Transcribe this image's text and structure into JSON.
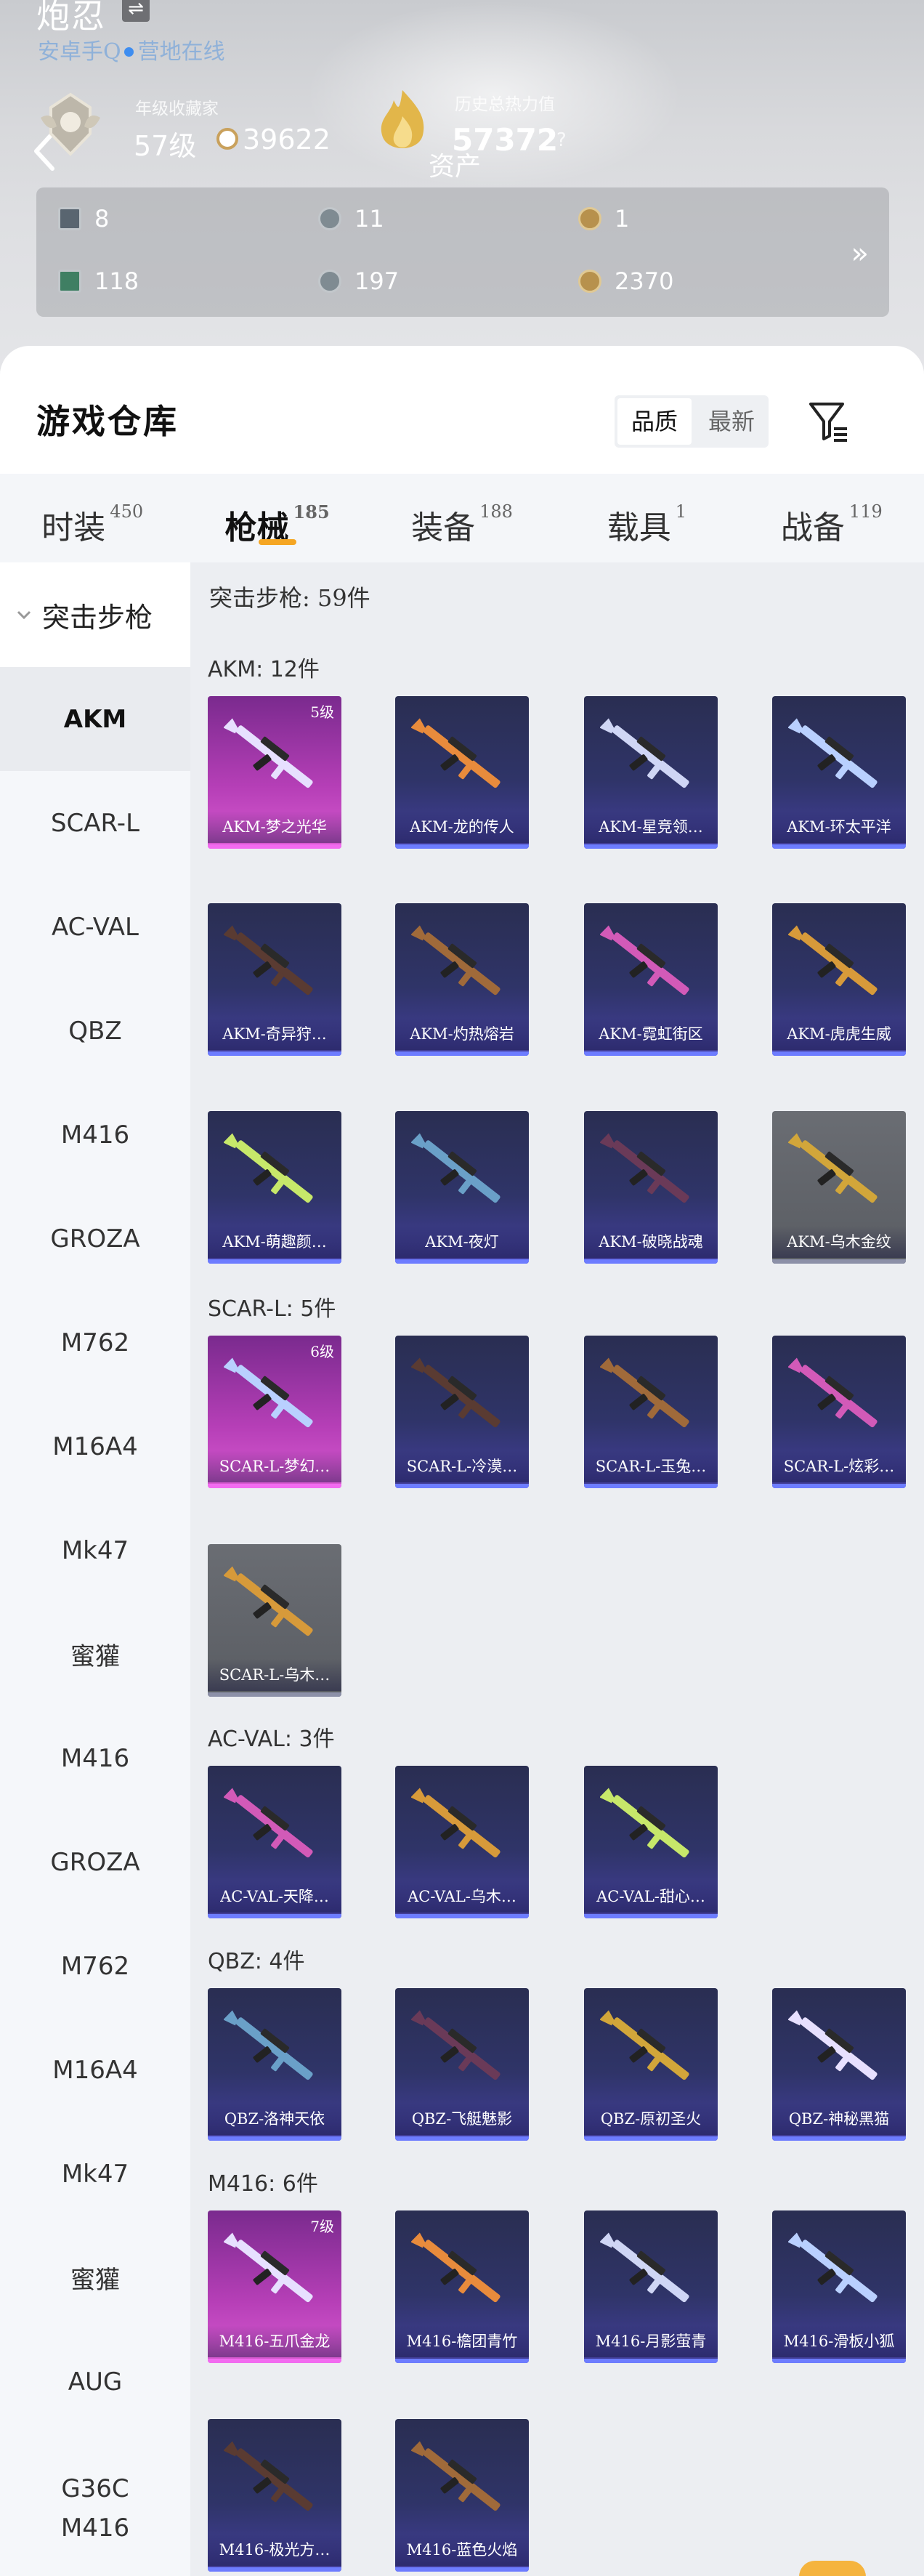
{
  "header": {
    "player_name": "炮忍",
    "region": "安卓手Q",
    "status": "营地在线",
    "label_collection": "年级收藏家",
    "level": "57级",
    "coins": "39622",
    "label_power": "历史总热力值",
    "power": "57372",
    "help": "?",
    "assets_title": "资产",
    "stats": [
      {
        "icon": "card-icon",
        "value": "8"
      },
      {
        "icon": "badge-icon",
        "value": "11"
      },
      {
        "icon": "coin-gold-icon",
        "value": "1"
      },
      {
        "icon": "ticket-icon",
        "value": "118"
      },
      {
        "icon": "sphere-icon",
        "value": "197"
      },
      {
        "icon": "medal-icon",
        "value": "2370"
      }
    ],
    "stats_more": "»"
  },
  "warehouse": {
    "title": "游戏仓库",
    "sort_options": [
      "品质",
      "最新"
    ],
    "sort_active": "品质"
  },
  "tabs": [
    {
      "label": "时装",
      "count": "450"
    },
    {
      "label": "枪械",
      "count": "185",
      "active": true
    },
    {
      "label": "装备",
      "count": "188"
    },
    {
      "label": "载具",
      "count": "1"
    },
    {
      "label": "战备",
      "count": "119"
    }
  ],
  "sidebar": {
    "category": "突击步枪",
    "items": [
      "AKM",
      "SCAR-L",
      "AC-VAL",
      "QBZ",
      "M416",
      "GROZA",
      "M762",
      "M16A4",
      "Mk47",
      "蜜獾",
      "M416",
      "GROZA",
      "M762",
      "M16A4",
      "Mk47",
      "蜜獾",
      "AUG",
      "G36C",
      "M416"
    ]
  },
  "main": {
    "section_title": "突击步枪: 59件",
    "groups": [
      {
        "title": "AKM: 12件",
        "items": [
          {
            "name": "AKM-梦之光华",
            "level": "5级",
            "rarity": "pink"
          },
          {
            "name": "AKM-龙的传人",
            "rarity": "blue"
          },
          {
            "name": "AKM-星竞领…",
            "rarity": "blue"
          },
          {
            "name": "AKM-环太平洋",
            "rarity": "blue"
          },
          {
            "name": "AKM-奇异狩…",
            "rarity": "blue"
          },
          {
            "name": "AKM-灼热熔岩",
            "rarity": "blue"
          },
          {
            "name": "AKM-霓虹街区",
            "rarity": "blue"
          },
          {
            "name": "AKM-虎虎生威",
            "rarity": "blue"
          },
          {
            "name": "AKM-萌趣颜…",
            "rarity": "blue"
          },
          {
            "name": "AKM-夜灯",
            "rarity": "blue"
          },
          {
            "name": "AKM-破晓战魂",
            "rarity": "blue"
          },
          {
            "name": "AKM-乌木金纹",
            "rarity": "gray"
          }
        ]
      },
      {
        "title": "SCAR-L: 5件",
        "items": [
          {
            "name": "SCAR-L-梦幻…",
            "level": "6级",
            "rarity": "pink"
          },
          {
            "name": "SCAR-L-冷漠…",
            "rarity": "blue"
          },
          {
            "name": "SCAR-L-玉兔…",
            "rarity": "blue"
          },
          {
            "name": "SCAR-L-炫彩…",
            "rarity": "blue"
          },
          {
            "name": "SCAR-L-乌木…",
            "rarity": "gray"
          }
        ]
      },
      {
        "title": "AC-VAL: 3件",
        "items": [
          {
            "name": "AC-VAL-天降…",
            "rarity": "blue"
          },
          {
            "name": "AC-VAL-乌木…",
            "rarity": "blue"
          },
          {
            "name": "AC-VAL-甜心…",
            "rarity": "blue"
          }
        ]
      },
      {
        "title": "QBZ: 4件",
        "items": [
          {
            "name": "QBZ-洛神天依",
            "rarity": "blue"
          },
          {
            "name": "QBZ-飞艇魅影",
            "rarity": "blue"
          },
          {
            "name": "QBZ-原初圣火",
            "rarity": "blue"
          },
          {
            "name": "QBZ-神秘黑猫",
            "rarity": "blue"
          }
        ]
      },
      {
        "title": "M416: 6件",
        "items": [
          {
            "name": "M416-五爪金龙",
            "level": "7级",
            "rarity": "pink"
          },
          {
            "name": "M416-檐团青竹",
            "rarity": "blue"
          },
          {
            "name": "M416-月影萤青",
            "rarity": "blue"
          },
          {
            "name": "M416-滑板小狐",
            "rarity": "blue"
          },
          {
            "name": "M416-极光方…",
            "rarity": "blue"
          },
          {
            "name": "M416-蓝色火焰",
            "rarity": "blue"
          }
        ]
      }
    ]
  },
  "colors": {
    "accent": "#f5a623",
    "online": "#3e8df0",
    "rarity_pink": "#d95bd2",
    "rarity_blue": "#433f9c",
    "rarity_gray": "#5a5d63"
  }
}
